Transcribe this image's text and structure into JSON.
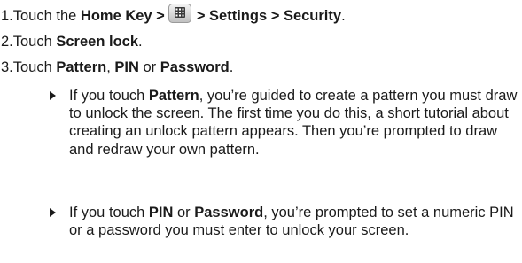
{
  "steps": {
    "step1": {
      "prefix": "1.Touch the ",
      "home_key": "Home Key >",
      "after_icon": "> Settings > Security",
      "period": "."
    },
    "step2": {
      "prefix": "2.Touch ",
      "screen_lock": "Screen lock",
      "period": "."
    },
    "step3": {
      "prefix": "3.Touch ",
      "pattern": "Pattern",
      "comma": ", ",
      "pin": "PIN",
      "or": " or ",
      "password": "Password",
      "period": "."
    }
  },
  "bullets": {
    "bullet1": {
      "lead": "If you touch ",
      "pattern": "Pattern",
      "body": ", you’re guided to create a pattern you must draw to unlock the screen. The first time you do this, a short tutorial about creating an unlock pattern appears. Then you’re prompted to draw and redraw your own pattern."
    },
    "bullet2": {
      "lead": "If you touch ",
      "pin": "PIN",
      "or": " or ",
      "password": "Password",
      "body": ", you’re prompted to set a numeric PIN or a password you must enter to unlock your screen."
    }
  },
  "icons": {
    "apps_icon": "apps-launcher-icon"
  }
}
